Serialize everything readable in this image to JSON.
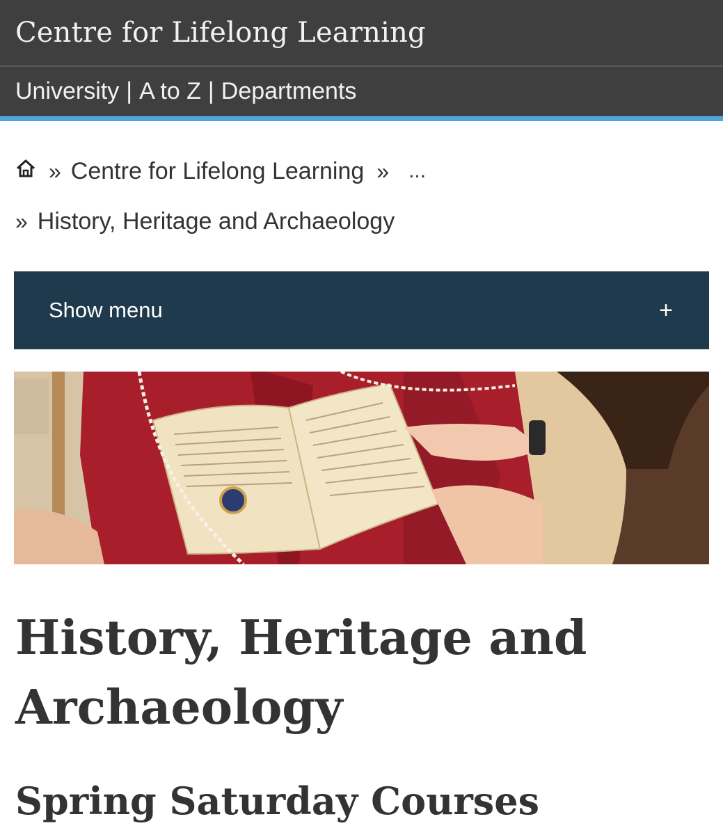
{
  "header": {
    "site_title": "Centre for Lifelong Learning"
  },
  "utility_nav": {
    "items": [
      "University",
      "A to Z",
      "Departments"
    ],
    "separator": "|"
  },
  "breadcrumb": {
    "home_icon": "home-icon",
    "separator": "»",
    "items": [
      "Centre for Lifelong Learning",
      "History, Heritage and Archaeology"
    ],
    "ellipsis": "..."
  },
  "menu": {
    "label": "Show menu",
    "toggle": "+"
  },
  "banner": {
    "alt": "hands turning pages of an illuminated manuscript on a red cushion"
  },
  "main": {
    "title": "History, Heritage and Archaeology",
    "subtitle": "Spring Saturday Courses"
  },
  "colors": {
    "header_bg": "#3f3f3f",
    "accent_rule": "#4fa6dd",
    "menu_bg": "#1e3a4c",
    "text": "#333333"
  }
}
